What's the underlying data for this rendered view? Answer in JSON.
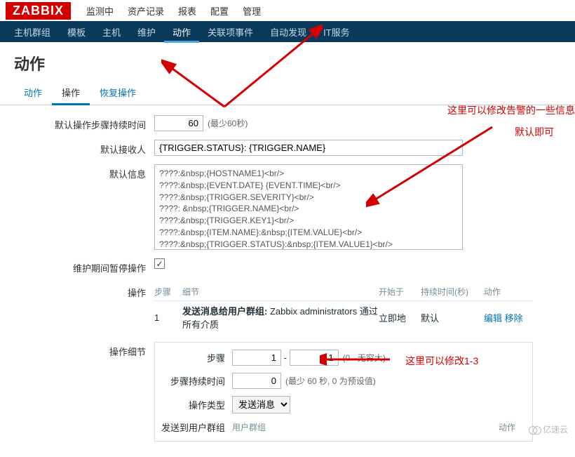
{
  "logo": "ZABBIX",
  "topnav": {
    "items": [
      "监测中",
      "资产记录",
      "报表",
      "配置",
      "管理"
    ],
    "activeIndex": 3
  },
  "subnav": {
    "items": [
      "主机群组",
      "模板",
      "主机",
      "维护",
      "动作",
      "关联项事件",
      "自动发现",
      "IT服务"
    ],
    "activeIndex": 4
  },
  "pageTitle": "动作",
  "tabs": {
    "items": [
      "动作",
      "操作",
      "恢复操作"
    ],
    "activeIndex": 1
  },
  "form": {
    "defaultStepDurationLabel": "默认操作步骤持续时间",
    "defaultStepDurationValue": "60",
    "defaultStepDurationHint": "(最少60秒)",
    "defaultRecipientLabel": "默认接收人",
    "defaultRecipientValue": "{TRIGGER.STATUS}: {TRIGGER.NAME}",
    "defaultMessageLabel": "默认信息",
    "defaultMessageValue": "????:&nbsp;{HOSTNAME1}<br/>\n????:&nbsp;{EVENT.DATE} {EVENT.TIME}<br/>\n????:&nbsp;{TRIGGER.SEVERITY}<br/>\n????: &nbsp;{TRIGGER.NAME}<br/>\n????:&nbsp;{TRIGGER.KEY1}<br/>\n????:&nbsp;{ITEM.NAME}:&nbsp;{ITEM.VALUE}<br/>\n????:&nbsp;{TRIGGER.STATUS}:&nbsp;{ITEM.VALUE1}<br/>\n??ID:&nbsp;{EVENT.ID}",
    "pauseMaintenanceLabel": "维护期间暂停操作",
    "operationsLabel": "操作",
    "operationsHeader": {
      "steps": "步骤",
      "detail": "细节",
      "start": "开始于",
      "duration": "持续时间(秒)",
      "action": "动作"
    },
    "operationsRow": {
      "index": "1",
      "prefix": "发送消息给用户群组:",
      "detail": " Zabbix administrators 通过 所有介质",
      "start": "立即地",
      "duration": "默认",
      "edit": "编辑",
      "remove": "移除"
    },
    "operationDetailLabel": "操作细节",
    "detail": {
      "stepLabel": "步骤",
      "stepFrom": "1",
      "stepTo": "1",
      "stepHint": "(0 - 无穷大)",
      "durationLabel": "步骤持续时间",
      "durationValue": "0",
      "durationHint": "(最少 60 秒, 0 为预设值)",
      "typeLabel": "操作类型",
      "typeValue": "发送消息",
      "sendToGroupLabel": "发送到用户群组",
      "sendToGroupHeader": "用户群组",
      "sendToGroupAction": "动作"
    }
  },
  "annotations": {
    "a1": "这里可以修改告警的一些信息",
    "a2": "默认即可",
    "a3": "这里可以修改1-3"
  },
  "watermark": "亿速云"
}
